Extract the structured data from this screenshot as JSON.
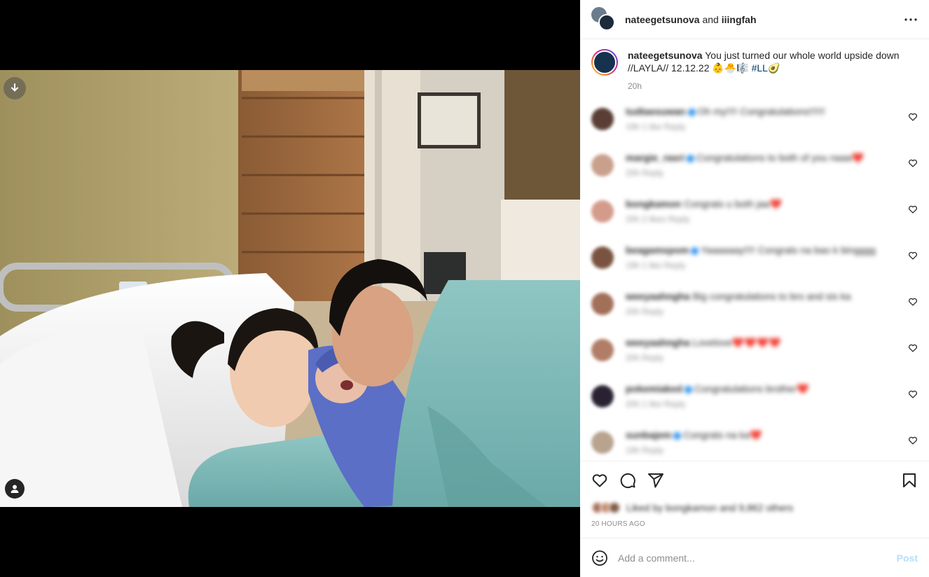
{
  "header": {
    "user1": "nateegetsunova",
    "joiner": "and",
    "user2": "iiingfah"
  },
  "caption": {
    "username": "nateegetsunova",
    "text": "You just turned our whole world upside down //LAYLA// 12.12.22",
    "emojis": "👶🐣🎼",
    "hashtag": "#LL",
    "emoji_end": "🥑",
    "time": "20h"
  },
  "comments": [
    {
      "user": "tudtaesuwan",
      "verified": true,
      "text": "Oh my!!!! Congratulations!!!!!!",
      "hearts": "",
      "meta": "19h   1 like   Reply",
      "color": "#5a3e36"
    },
    {
      "user": "margie_rasri",
      "verified": true,
      "text": "Congratulations to both of you naaa",
      "hearts": "❤️",
      "meta": "20h   Reply",
      "color": "#c9a08c"
    },
    {
      "user": "bongkamon",
      "verified": false,
      "text": "Congrats u both jaa",
      "hearts": "❤️",
      "meta": "20h   2 likes   Reply",
      "color": "#d49b8a"
    },
    {
      "user": "beagamspom",
      "verified": true,
      "text": "Yaaaaaay!!!! Congrats na bao k bingggg",
      "hearts": "",
      "meta": "19h   1 like   Reply",
      "color": "#7a5340"
    },
    {
      "user": "weeyaahngha",
      "verified": false,
      "text": "Big congratulations to bro and sis ka",
      "hearts": "",
      "meta": "20h   Reply",
      "color": "#a26f58"
    },
    {
      "user": "weeyaahngha",
      "verified": false,
      "text": "Lovelove",
      "hearts": "❤️❤️❤️❤️",
      "meta": "20h   Reply",
      "color": "#b27d66"
    },
    {
      "user": "pokemiaked",
      "verified": true,
      "text": "Congratulations brother",
      "hearts": "❤️",
      "meta": "20h   1 like   Reply",
      "color": "#2a2233"
    },
    {
      "user": "sunbajem",
      "verified": true,
      "text": "Congrats na ka",
      "hearts": "❤️",
      "meta": "19h   Reply",
      "color": "#b8a38f"
    }
  ],
  "likes": {
    "text": "Liked by bongkamon and 9,862 others"
  },
  "time_ago": "20 HOURS AGO",
  "comment_box": {
    "placeholder": "Add a comment...",
    "post_label": "Post"
  },
  "icons": {
    "download": "download-icon",
    "tag": "user-tag-icon",
    "more": "more-horizontal-icon",
    "like": "heart-icon",
    "comment": "comment-icon",
    "share": "share-icon",
    "save": "bookmark-icon",
    "emoji": "emoji-icon"
  }
}
